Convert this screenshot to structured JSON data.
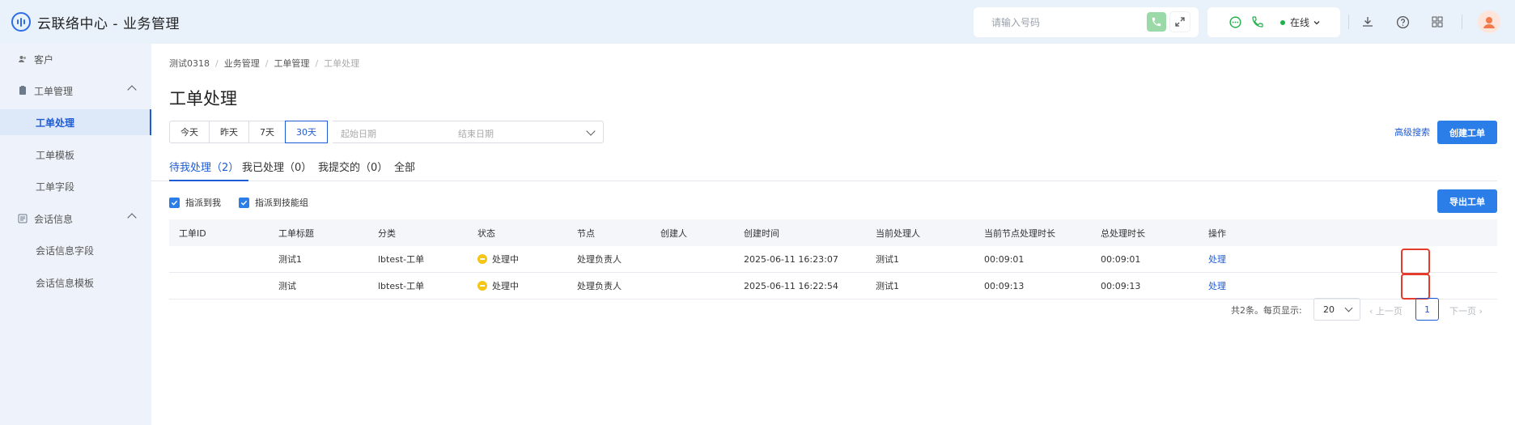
{
  "app": {
    "title": "云联络中心 - 业务管理"
  },
  "header": {
    "phone_placeholder": "请输入号码",
    "status": "在线",
    "icons": [
      "call-icon",
      "expand-icon",
      "chat-icon",
      "phone-icon",
      "download-icon",
      "help-icon",
      "apps-icon",
      "avatar"
    ]
  },
  "sidebar": {
    "items": [
      {
        "label": "客户",
        "icon": "customer-icon"
      },
      {
        "label": "工单管理",
        "icon": "ticket-icon"
      },
      {
        "label": "工单处理",
        "active": true
      },
      {
        "label": "工单模板"
      },
      {
        "label": "工单字段"
      },
      {
        "label": "会话信息",
        "icon": "session-icon"
      },
      {
        "label": "会话信息字段"
      },
      {
        "label": "会话信息模板"
      }
    ]
  },
  "breadcrumb": [
    "测试0318",
    "业务管理",
    "工单管理",
    "工单处理"
  ],
  "page_title": "工单处理",
  "range_buttons": [
    "今天",
    "昨天",
    "7天",
    "30天"
  ],
  "range_selected": "30天",
  "date_start_placeholder": "起始日期",
  "date_end_placeholder": "结束日期",
  "advanced_search": "高级搜索",
  "create_button": "创建工单",
  "export_button": "导出工单",
  "tabs": [
    "待我处理（2）",
    "我已处理（0）",
    "我提交的（0）",
    "全部"
  ],
  "active_tab": 0,
  "checkboxes": [
    {
      "label": "指派到我",
      "checked": true
    },
    {
      "label": "指派到技能组",
      "checked": true
    }
  ],
  "table": {
    "headers": [
      "工单ID",
      "工单标题",
      "分类",
      "状态",
      "节点",
      "创建人",
      "创建时间",
      "当前处理人",
      "当前节点处理时长",
      "总处理时长",
      "操作"
    ],
    "rows": [
      {
        "id": "",
        "title": "测试1",
        "category": "lbtest-工单",
        "status": "处理中",
        "node": "处理负责人",
        "creator": "",
        "created": "2025-06-11 16:23:07",
        "handler": "测试1",
        "node_duration": "00:09:01",
        "total_duration": "00:09:01",
        "action": "处理"
      },
      {
        "id": "",
        "title": "测试",
        "category": "lbtest-工单",
        "status": "处理中",
        "node": "处理负责人",
        "creator": "",
        "created": "2025-06-11 16:22:54",
        "handler": "测试1",
        "node_duration": "00:09:13",
        "total_duration": "00:09:13",
        "action": "处理"
      }
    ]
  },
  "pagination": {
    "summary": "共2条。每页显示:",
    "page_size": "20",
    "prev": "上一页",
    "current": "1",
    "next": "下一页"
  },
  "colors": {
    "primary": "#2b7de8",
    "highlight": "#e33b2c",
    "status_processing": "#f5c518",
    "online": "#22b14c"
  }
}
